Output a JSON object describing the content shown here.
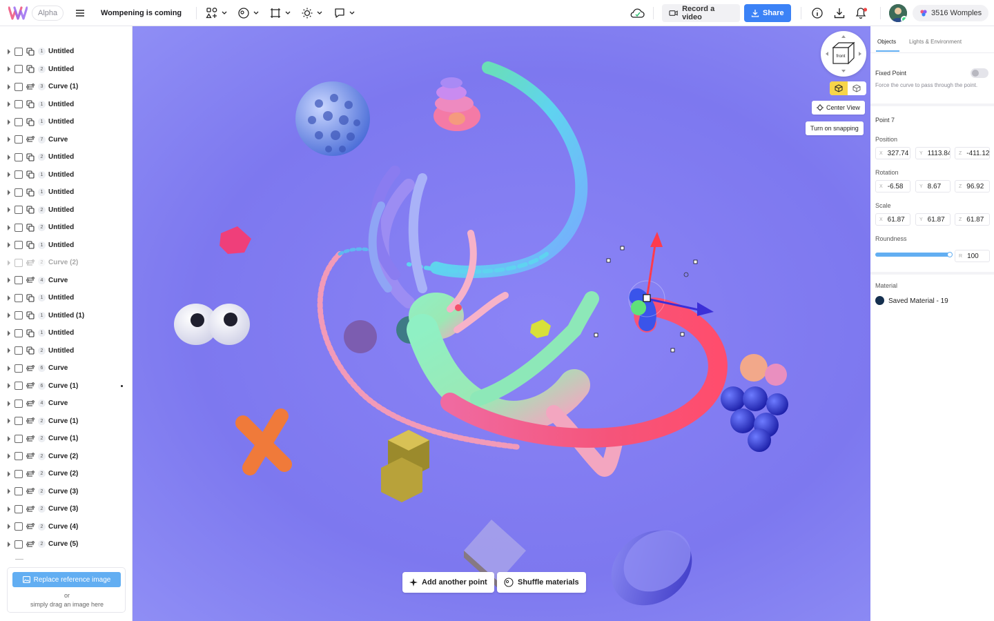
{
  "app": {
    "stage_label": "Alpha",
    "project_title": "Wompening is coming"
  },
  "toolbar": {
    "record_label": "Record a video",
    "share_label": "Share",
    "womples_count": "3516 Womples"
  },
  "layers": [
    {
      "count": "1",
      "name": "Untitled",
      "kind": "object"
    },
    {
      "count": "2",
      "name": "Untitled",
      "kind": "object"
    },
    {
      "count": "3",
      "name": "Curve (1)",
      "kind": "curve"
    },
    {
      "count": "1",
      "name": "Untitled",
      "kind": "object"
    },
    {
      "count": "1",
      "name": "Untitled",
      "kind": "object"
    },
    {
      "count": "7",
      "name": "Curve",
      "kind": "curve"
    },
    {
      "count": "2",
      "name": "Untitled",
      "kind": "object"
    },
    {
      "count": "1",
      "name": "Untitled",
      "kind": "object"
    },
    {
      "count": "1",
      "name": "Untitled",
      "kind": "object"
    },
    {
      "count": "2",
      "name": "Untitled",
      "kind": "object"
    },
    {
      "count": "2",
      "name": "Untitled",
      "kind": "object"
    },
    {
      "count": "1",
      "name": "Untitled",
      "kind": "object"
    },
    {
      "count": "2",
      "name": "Curve (2)",
      "kind": "curve",
      "hidden": true
    },
    {
      "count": "4",
      "name": "Curve",
      "kind": "curve"
    },
    {
      "count": "1",
      "name": "Untitled",
      "kind": "object"
    },
    {
      "count": "1",
      "name": "Untitled (1)",
      "kind": "object"
    },
    {
      "count": "1",
      "name": "Untitled",
      "kind": "object"
    },
    {
      "count": "2",
      "name": "Untitled",
      "kind": "object"
    },
    {
      "count": "6",
      "name": "Curve",
      "kind": "curve"
    },
    {
      "count": "6",
      "name": "Curve (1)",
      "kind": "curve",
      "active": true
    },
    {
      "count": "4",
      "name": "Curve",
      "kind": "curve"
    },
    {
      "count": "2",
      "name": "Curve (1)",
      "kind": "curve"
    },
    {
      "count": "2",
      "name": "Curve (1)",
      "kind": "curve"
    },
    {
      "count": "2",
      "name": "Curve (2)",
      "kind": "curve"
    },
    {
      "count": "2",
      "name": "Curve (2)",
      "kind": "curve"
    },
    {
      "count": "2",
      "name": "Curve (3)",
      "kind": "curve"
    },
    {
      "count": "2",
      "name": "Curve (3)",
      "kind": "curve"
    },
    {
      "count": "2",
      "name": "Curve (4)",
      "kind": "curve"
    },
    {
      "count": "2",
      "name": "Curve (5)",
      "kind": "curve"
    }
  ],
  "reference": {
    "button_label": "Replace reference image",
    "or_text": "or",
    "drag_text": "simply drag an image here"
  },
  "viewport": {
    "cube_face_label": "front",
    "center_view_label": "Center View",
    "snapping_label": "Turn on snapping",
    "add_point_label": "Add another point",
    "shuffle_label": "Shuffle materials"
  },
  "panel": {
    "tabs": [
      "Objects",
      "Lights & Environment"
    ],
    "fixed_point": {
      "title": "Fixed Point",
      "description": "Force the curve to pass through the point.",
      "enabled": false
    },
    "point_title": "Point 7",
    "position": {
      "label": "Position",
      "x": "327.74",
      "y": "1113.84",
      "z": "-411.12"
    },
    "rotation": {
      "label": "Rotation",
      "x": "-6.58",
      "y": "8.67",
      "z": "96.92"
    },
    "scale": {
      "label": "Scale",
      "x": "61.87",
      "y": "61.87",
      "z": "61.87"
    },
    "roundness": {
      "label": "Roundness",
      "axis": "R",
      "value": "100",
      "level": 1.0
    },
    "material": {
      "label": "Material",
      "name": "Saved Material - 19",
      "color": "#15304f"
    },
    "axis_labels": {
      "x": "X",
      "y": "Y",
      "z": "Z"
    }
  },
  "colors": {
    "accent": "#3b82f6",
    "slider": "#62aef2",
    "viewport_bg": "#807af0",
    "selected_mode": "#f7d54a"
  }
}
